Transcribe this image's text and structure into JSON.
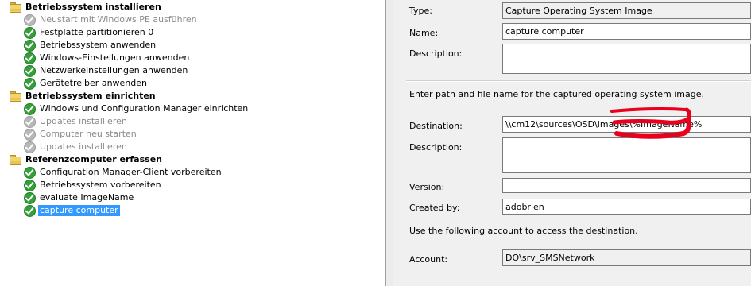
{
  "tree": {
    "groups": [
      {
        "label": "Betriebssystem installieren",
        "items": [
          {
            "label": "Neustart mit Windows PE ausführen",
            "status": "disabled"
          },
          {
            "label": "Festplatte partitionieren 0",
            "status": "enabled"
          },
          {
            "label": "Betriebssystem anwenden",
            "status": "enabled"
          },
          {
            "label": "Windows-Einstellungen anwenden",
            "status": "enabled"
          },
          {
            "label": "Netzwerkeinstellungen anwenden",
            "status": "enabled"
          },
          {
            "label": "Gerätetreiber anwenden",
            "status": "enabled"
          }
        ]
      },
      {
        "label": "Betriebssystem einrichten",
        "items": [
          {
            "label": "Windows und Configuration Manager einrichten",
            "status": "enabled"
          },
          {
            "label": "Updates installieren",
            "status": "disabled"
          },
          {
            "label": "Computer neu starten",
            "status": "disabled"
          },
          {
            "label": "Updates installieren",
            "status": "disabled"
          }
        ]
      },
      {
        "label": "Referenzcomputer erfassen",
        "items": [
          {
            "label": "Configuration Manager-Client vorbereiten",
            "status": "enabled"
          },
          {
            "label": "Betriebssystem vorbereiten",
            "status": "enabled"
          },
          {
            "label": "evaluate ImageName",
            "status": "enabled"
          },
          {
            "label": "capture computer",
            "status": "selected"
          }
        ]
      }
    ]
  },
  "props": {
    "type_label": "Type:",
    "type_value": "Capture Operating System Image",
    "name_label": "Name:",
    "name_value": "capture computer",
    "desc_label": "Description:",
    "desc_value": "",
    "path_note": "Enter path and file name for the captured operating system image.",
    "dest_label": "Destination:",
    "dest_value": "\\\\cm12\\sources\\OSD\\Images\\%ImageName%",
    "desc2_label": "Description:",
    "desc2_value": "",
    "version_label": "Version:",
    "version_value": "",
    "createdby_label": "Created by:",
    "createdby_value": "adobrien",
    "account_note": "Use the following account to access the destination.",
    "account_label": "Account:",
    "account_value": "DO\\srv_SMSNetwork"
  },
  "colors": {
    "selection": "#3399ff",
    "check": "#35a03a",
    "annotation": "#e8001c"
  }
}
